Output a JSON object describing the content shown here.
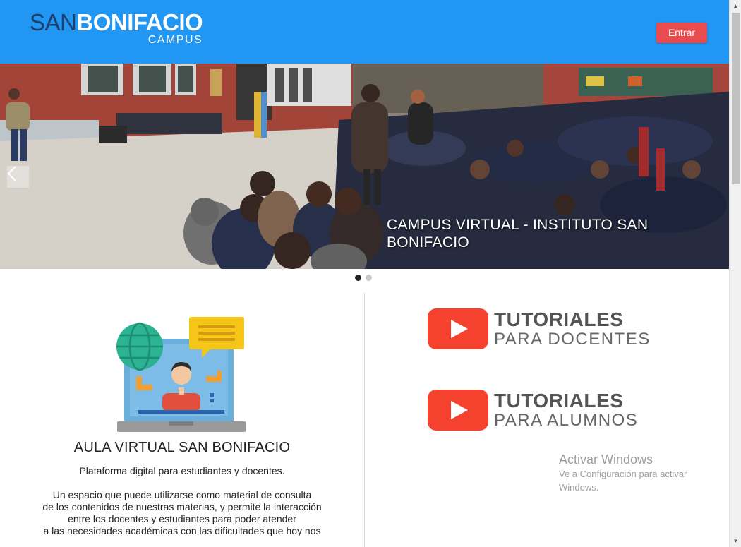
{
  "header": {
    "logo": {
      "part1": "SAN",
      "part2": "BONIFACIO",
      "sub": "CAMPUS"
    },
    "login_button": "Entrar",
    "colors": {
      "bar": "#2196f3",
      "button": "#e84c4f"
    }
  },
  "carousel": {
    "caption": "CAMPUS VIRTUAL - INSTITUTO SAN BONIFACIO",
    "prev_icon": "chevron-left-icon",
    "slides_total": 2,
    "active_slide": 1
  },
  "aula": {
    "title": "AULA VIRTUAL SAN BONIFACIO",
    "subtitle": "Plataforma digital para estudiantes y docentes.",
    "description_lines": [
      "Un espacio que puede utilizarse como material de consulta",
      "de los contenidos de nuestras materias, y permite la interacción",
      "entre los docentes y estudiantes para poder atender",
      "a las necesidades académicas con las dificultades que hoy nos"
    ]
  },
  "tutorials": [
    {
      "title": "TUTORIALES",
      "subtitle": "PARA DOCENTES",
      "icon": "youtube-play-icon"
    },
    {
      "title": "TUTORIALES",
      "subtitle": "PARA ALUMNOS",
      "icon": "youtube-play-icon"
    }
  ],
  "watermark": {
    "title": "Activar Windows",
    "subtitle": "Ve a Configuración para activar Windows."
  }
}
